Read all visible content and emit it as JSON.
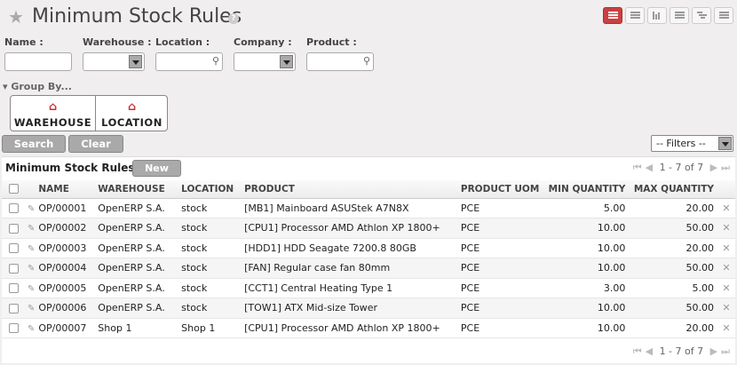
{
  "header": {
    "title": "Minimum Stock Rules",
    "help": "?"
  },
  "filters": {
    "name_label": "Name :",
    "warehouse_label": "Warehouse :",
    "location_label": "Location :",
    "company_label": "Company :",
    "product_label": "Product :",
    "group_by_label": "▾ Group By...",
    "group_warehouse": "WAREHOUSE",
    "group_location": "LOCATION",
    "search": "Search",
    "clear": "Clear",
    "filters_select": "-- Filters --"
  },
  "list": {
    "title": "Minimum Stock Rules",
    "new": "New",
    "pager": "1 - 7 of 7",
    "columns": [
      "NAME",
      "WAREHOUSE",
      "LOCATION",
      "PRODUCT",
      "PRODUCT UOM",
      "MIN QUANTITY",
      "MAX QUANTITY"
    ],
    "rows": [
      [
        "OP/00001",
        "OpenERP S.A.",
        "stock",
        "[MB1] Mainboard ASUStek A7N8X",
        "PCE",
        "5.00",
        "20.00"
      ],
      [
        "OP/00002",
        "OpenERP S.A.",
        "stock",
        "[CPU1] Processor AMD Athlon XP 1800+",
        "PCE",
        "10.00",
        "50.00"
      ],
      [
        "OP/00003",
        "OpenERP S.A.",
        "stock",
        "[HDD1] HDD Seagate 7200.8 80GB",
        "PCE",
        "10.00",
        "20.00"
      ],
      [
        "OP/00004",
        "OpenERP S.A.",
        "stock",
        "[FAN] Regular case fan 80mm",
        "PCE",
        "10.00",
        "50.00"
      ],
      [
        "OP/00005",
        "OpenERP S.A.",
        "stock",
        "[CCT1] Central Heating Type 1",
        "PCE",
        "3.00",
        "5.00"
      ],
      [
        "OP/00006",
        "OpenERP S.A.",
        "stock",
        "[TOW1] ATX Mid-size Tower",
        "PCE",
        "10.00",
        "50.00"
      ],
      [
        "OP/00007",
        "Shop 1",
        "Shop 1",
        "[CPU1] Processor AMD Athlon XP 1800+",
        "PCE",
        "10.00",
        "20.00"
      ]
    ]
  },
  "colors": {
    "accent": "#c94040",
    "button_gray": "#a9a9a9"
  }
}
